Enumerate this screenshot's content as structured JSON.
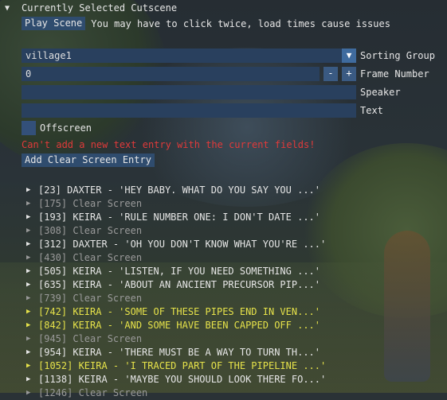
{
  "header": {
    "title": "Currently Selected Cutscene"
  },
  "play": {
    "button": "Play Scene",
    "hint": "You may have to click twice, load times cause issues"
  },
  "fields": {
    "sorting_group": {
      "value": "village1",
      "label": "Sorting Group"
    },
    "frame_number": {
      "value": "0",
      "label": "Frame Number",
      "minus": "-",
      "plus": "+"
    },
    "speaker": {
      "value": "",
      "label": "Speaker"
    },
    "text": {
      "value": "",
      "label": "Text"
    },
    "offscreen": {
      "label": "Offscreen",
      "checked": false
    }
  },
  "error": "Can't add a new text entry with the current fields!",
  "add_clear_button": "Add Clear Screen Entry",
  "entries": [
    {
      "text": "[23] DAXTER - 'HEY BABY. WHAT DO YOU SAY YOU ...'",
      "style": "white"
    },
    {
      "text": "[175] Clear Screen",
      "style": "gray"
    },
    {
      "text": "[193] KEIRA - 'RULE NUMBER ONE: I DON'T DATE ...'",
      "style": "white"
    },
    {
      "text": "[308] Clear Screen",
      "style": "gray"
    },
    {
      "text": "[312] DAXTER - 'OH YOU DON'T KNOW WHAT YOU'RE ...'",
      "style": "white"
    },
    {
      "text": "[430] Clear Screen",
      "style": "gray"
    },
    {
      "text": "[505] KEIRA - 'LISTEN, IF YOU NEED SOMETHING ...'",
      "style": "white"
    },
    {
      "text": "[635] KEIRA - 'ABOUT AN ANCIENT PRECURSOR PIP...'",
      "style": "white"
    },
    {
      "text": "[739] Clear Screen",
      "style": "gray"
    },
    {
      "text": "[742] KEIRA - 'SOME OF THESE PIPES END IN VEN...'",
      "style": "yellow"
    },
    {
      "text": "[842] KEIRA - 'AND SOME HAVE BEEN CAPPED OFF ...'",
      "style": "yellow"
    },
    {
      "text": "[945] Clear Screen",
      "style": "gray"
    },
    {
      "text": "[954] KEIRA - 'THERE MUST BE A WAY TO TURN TH...'",
      "style": "white"
    },
    {
      "text": "[1052] KEIRA - 'I TRACED PART OF THE PIPELINE ...'",
      "style": "yellow"
    },
    {
      "text": "[1138] KEIRA - 'MAYBE YOU SHOULD LOOK THERE FO...'",
      "style": "white"
    },
    {
      "text": "[1246] Clear Screen",
      "style": "gray"
    }
  ],
  "colors": {
    "button": "#2f4c6e",
    "frame": "#29405e",
    "error": "#e03a3a",
    "highlight": "#e6e24a"
  }
}
